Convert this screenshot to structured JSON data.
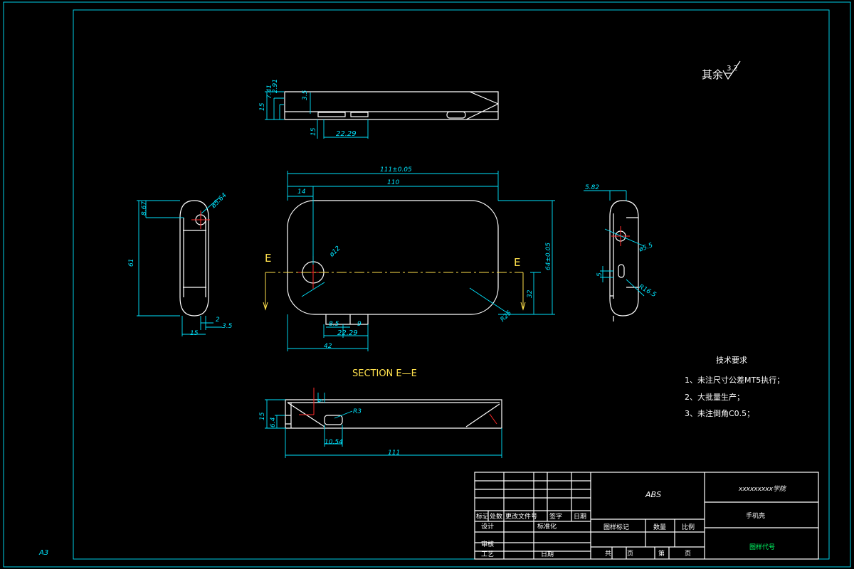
{
  "sheet": {
    "size_label": "A3",
    "surface_finish": "其余",
    "roughness_value": "3.2"
  },
  "top_view": {
    "dims": [
      "15",
      "7.41",
      "2.91",
      "3.5",
      "15",
      "22.29"
    ]
  },
  "front_view": {
    "dims": {
      "overall_tol": "111±0.05",
      "length": "110",
      "offset": "14",
      "hole_dia": "ø12",
      "height_tol": "64±0.05",
      "half_height": "32",
      "corner": "R25",
      "w1": "8.5",
      "w2": "9",
      "w3": "22.29",
      "w4": "42"
    },
    "section_marks": [
      "E",
      "E"
    ]
  },
  "left_view": {
    "dims": [
      "8.67",
      "ø5.64",
      "61",
      "2",
      "3.5",
      "15"
    ]
  },
  "right_view": {
    "dims": [
      "5.82",
      "ø5.5",
      "5",
      "R16.5"
    ]
  },
  "section_view": {
    "title": "SECTION E—E",
    "dims": [
      "15",
      "6.4",
      "9",
      "R3",
      "10.54",
      "111"
    ]
  },
  "tech_requirements": {
    "title": "技术要求",
    "items": [
      "1、未注尺寸公差MT5执行；",
      "2、大批量生产；",
      "3、未注倒角C0.5；"
    ]
  },
  "title_block": {
    "material": "ABS",
    "school": "xxxxxxxxx学院",
    "part_name": "手机壳",
    "drawing_no": "图样代号",
    "headers": [
      "标记",
      "处数",
      "更改文件号",
      "签字",
      "日期"
    ],
    "design": "设计",
    "standard": "标准化",
    "review": "审核",
    "process": "工艺",
    "date": "日期",
    "mark_label": "图样标记",
    "qty_label": "数量",
    "scale_label": "比例",
    "total": "共",
    "page": "页",
    "sheet_no": "第",
    "page2": "页"
  },
  "colors": {
    "background": "#000000",
    "dimension": "#00e5ff",
    "outline": "#ffffff",
    "centerline": "#ffe14d",
    "axis": "#ff2a2a",
    "title_text": "#00ff66"
  }
}
